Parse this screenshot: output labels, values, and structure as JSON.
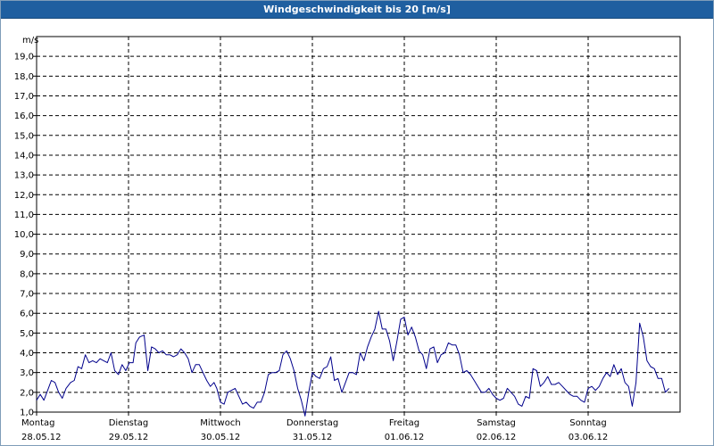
{
  "window": {
    "title": "Windgeschwindigkeit bis 20 [m/s]"
  },
  "chart_data": {
    "type": "line",
    "title": "Windgeschwindigkeit bis 20 [m/s]",
    "ylabel": "m/s",
    "ylim": [
      1,
      20
    ],
    "xlim": [
      0,
      7
    ],
    "yticks": [
      "1,0",
      "2,0",
      "3,0",
      "4,0",
      "5,0",
      "6,0",
      "7,0",
      "8,0",
      "9,0",
      "10,0",
      "11,0",
      "12,0",
      "13,0",
      "14,0",
      "15,0",
      "16,0",
      "17,0",
      "18,0",
      "19,0"
    ],
    "day_labels": [
      {
        "day": "Montag",
        "date": "28.05.12"
      },
      {
        "day": "Dienstag",
        "date": "29.05.12"
      },
      {
        "day": "Mittwoch",
        "date": "30.05.12"
      },
      {
        "day": "Donnerstag",
        "date": "31.05.12"
      },
      {
        "day": "Freitag",
        "date": "01.06.12"
      },
      {
        "day": "Samstag",
        "date": "02.06.12"
      },
      {
        "day": "Sonntag",
        "date": "03.06.12"
      }
    ],
    "grid": true,
    "line_color": "#00008b",
    "series": [
      {
        "x_unit": "days since Montag 00:00",
        "points": [
          [
            0.0,
            1.6
          ],
          [
            0.04,
            1.9
          ],
          [
            0.08,
            1.6
          ],
          [
            0.12,
            2.1
          ],
          [
            0.16,
            2.6
          ],
          [
            0.2,
            2.5
          ],
          [
            0.24,
            2.0
          ],
          [
            0.28,
            1.7
          ],
          [
            0.32,
            2.2
          ],
          [
            0.37,
            2.5
          ],
          [
            0.41,
            2.6
          ],
          [
            0.45,
            3.3
          ],
          [
            0.49,
            3.2
          ],
          [
            0.53,
            3.9
          ],
          [
            0.57,
            3.5
          ],
          [
            0.61,
            3.6
          ],
          [
            0.65,
            3.5
          ],
          [
            0.69,
            3.7
          ],
          [
            0.73,
            3.6
          ],
          [
            0.77,
            3.5
          ],
          [
            0.81,
            4.0
          ],
          [
            0.85,
            3.1
          ],
          [
            0.89,
            2.9
          ],
          [
            0.93,
            3.4
          ],
          [
            0.97,
            3.1
          ],
          [
            1.01,
            3.5
          ],
          [
            1.05,
            3.5
          ],
          [
            1.08,
            4.5
          ],
          [
            1.12,
            4.8
          ],
          [
            1.17,
            4.9
          ],
          [
            1.21,
            3.1
          ],
          [
            1.25,
            4.3
          ],
          [
            1.29,
            4.2
          ],
          [
            1.33,
            4.0
          ],
          [
            1.37,
            4.1
          ],
          [
            1.41,
            3.9
          ],
          [
            1.45,
            3.9
          ],
          [
            1.49,
            3.8
          ],
          [
            1.53,
            3.9
          ],
          [
            1.57,
            4.2
          ],
          [
            1.61,
            4.0
          ],
          [
            1.65,
            3.7
          ],
          [
            1.69,
            3.0
          ],
          [
            1.73,
            3.4
          ],
          [
            1.77,
            3.4
          ],
          [
            1.81,
            3.0
          ],
          [
            1.85,
            2.6
          ],
          [
            1.89,
            2.3
          ],
          [
            1.93,
            2.5
          ],
          [
            1.96,
            2.2
          ],
          [
            2.0,
            1.5
          ],
          [
            2.04,
            1.4
          ],
          [
            2.08,
            2.0
          ],
          [
            2.12,
            2.1
          ],
          [
            2.16,
            2.2
          ],
          [
            2.2,
            1.8
          ],
          [
            2.24,
            1.4
          ],
          [
            2.28,
            1.5
          ],
          [
            2.32,
            1.3
          ],
          [
            2.36,
            1.2
          ],
          [
            2.4,
            1.5
          ],
          [
            2.44,
            1.5
          ],
          [
            2.48,
            2.0
          ],
          [
            2.52,
            2.9
          ],
          [
            2.56,
            3.0
          ],
          [
            2.6,
            3.0
          ],
          [
            2.64,
            3.1
          ],
          [
            2.68,
            3.9
          ],
          [
            2.72,
            4.1
          ],
          [
            2.76,
            3.7
          ],
          [
            2.8,
            3.1
          ],
          [
            2.84,
            2.2
          ],
          [
            2.88,
            1.6
          ],
          [
            2.92,
            0.8
          ],
          [
            2.96,
            2.0
          ],
          [
            3.0,
            3.0
          ],
          [
            3.04,
            2.8
          ],
          [
            3.08,
            2.7
          ],
          [
            3.12,
            3.2
          ],
          [
            3.16,
            3.3
          ],
          [
            3.2,
            3.8
          ],
          [
            3.24,
            2.6
          ],
          [
            3.28,
            2.7
          ],
          [
            3.32,
            2.0
          ],
          [
            3.36,
            2.5
          ],
          [
            3.4,
            3.0
          ],
          [
            3.44,
            3.0
          ],
          [
            3.48,
            2.9
          ],
          [
            3.52,
            4.0
          ],
          [
            3.56,
            3.6
          ],
          [
            3.6,
            4.3
          ],
          [
            3.64,
            4.8
          ],
          [
            3.68,
            5.2
          ],
          [
            3.72,
            6.1
          ],
          [
            3.76,
            5.2
          ],
          [
            3.8,
            5.2
          ],
          [
            3.84,
            4.6
          ],
          [
            3.88,
            3.6
          ],
          [
            3.92,
            4.6
          ],
          [
            3.96,
            5.7
          ],
          [
            4.0,
            5.8
          ],
          [
            4.04,
            4.9
          ],
          [
            4.08,
            5.3
          ],
          [
            4.12,
            4.8
          ],
          [
            4.16,
            4.1
          ],
          [
            4.2,
            3.9
          ],
          [
            4.24,
            3.2
          ],
          [
            4.28,
            4.2
          ],
          [
            4.32,
            4.3
          ],
          [
            4.36,
            3.5
          ],
          [
            4.4,
            3.9
          ],
          [
            4.44,
            4.0
          ],
          [
            4.48,
            4.5
          ],
          [
            4.52,
            4.4
          ],
          [
            4.56,
            4.4
          ],
          [
            4.6,
            3.9
          ],
          [
            4.64,
            3.0
          ],
          [
            4.68,
            3.1
          ],
          [
            4.72,
            2.9
          ],
          [
            4.76,
            2.6
          ],
          [
            4.8,
            2.3
          ],
          [
            4.84,
            2.0
          ],
          [
            4.88,
            2.0
          ],
          [
            4.92,
            2.2
          ],
          [
            4.96,
            1.9
          ],
          [
            5.0,
            1.7
          ],
          [
            5.04,
            1.6
          ],
          [
            5.08,
            1.7
          ],
          [
            5.12,
            2.2
          ],
          [
            5.16,
            2.0
          ],
          [
            5.2,
            1.8
          ],
          [
            5.24,
            1.4
          ],
          [
            5.28,
            1.3
          ],
          [
            5.32,
            1.8
          ],
          [
            5.36,
            1.7
          ],
          [
            5.4,
            3.2
          ],
          [
            5.44,
            3.1
          ],
          [
            5.48,
            2.3
          ],
          [
            5.52,
            2.5
          ],
          [
            5.56,
            2.8
          ],
          [
            5.6,
            2.4
          ],
          [
            5.64,
            2.4
          ],
          [
            5.68,
            2.5
          ],
          [
            5.72,
            2.3
          ],
          [
            5.76,
            2.1
          ],
          [
            5.8,
            1.9
          ],
          [
            5.84,
            1.8
          ],
          [
            5.88,
            1.8
          ],
          [
            5.92,
            1.6
          ],
          [
            5.96,
            1.5
          ],
          [
            6.0,
            2.2
          ],
          [
            6.04,
            2.3
          ],
          [
            6.08,
            2.1
          ],
          [
            6.12,
            2.3
          ],
          [
            6.16,
            2.7
          ],
          [
            6.2,
            3.0
          ],
          [
            6.24,
            2.8
          ],
          [
            6.28,
            3.4
          ],
          [
            6.32,
            2.9
          ],
          [
            6.36,
            3.2
          ],
          [
            6.4,
            2.5
          ],
          [
            6.44,
            2.3
          ],
          [
            6.48,
            1.3
          ],
          [
            6.52,
            2.5
          ],
          [
            6.56,
            5.5
          ],
          [
            6.6,
            4.8
          ],
          [
            6.64,
            3.6
          ],
          [
            6.68,
            3.3
          ],
          [
            6.72,
            3.2
          ],
          [
            6.76,
            2.7
          ],
          [
            6.8,
            2.7
          ],
          [
            6.84,
            2.0
          ],
          [
            6.88,
            2.2
          ]
        ]
      }
    ]
  }
}
